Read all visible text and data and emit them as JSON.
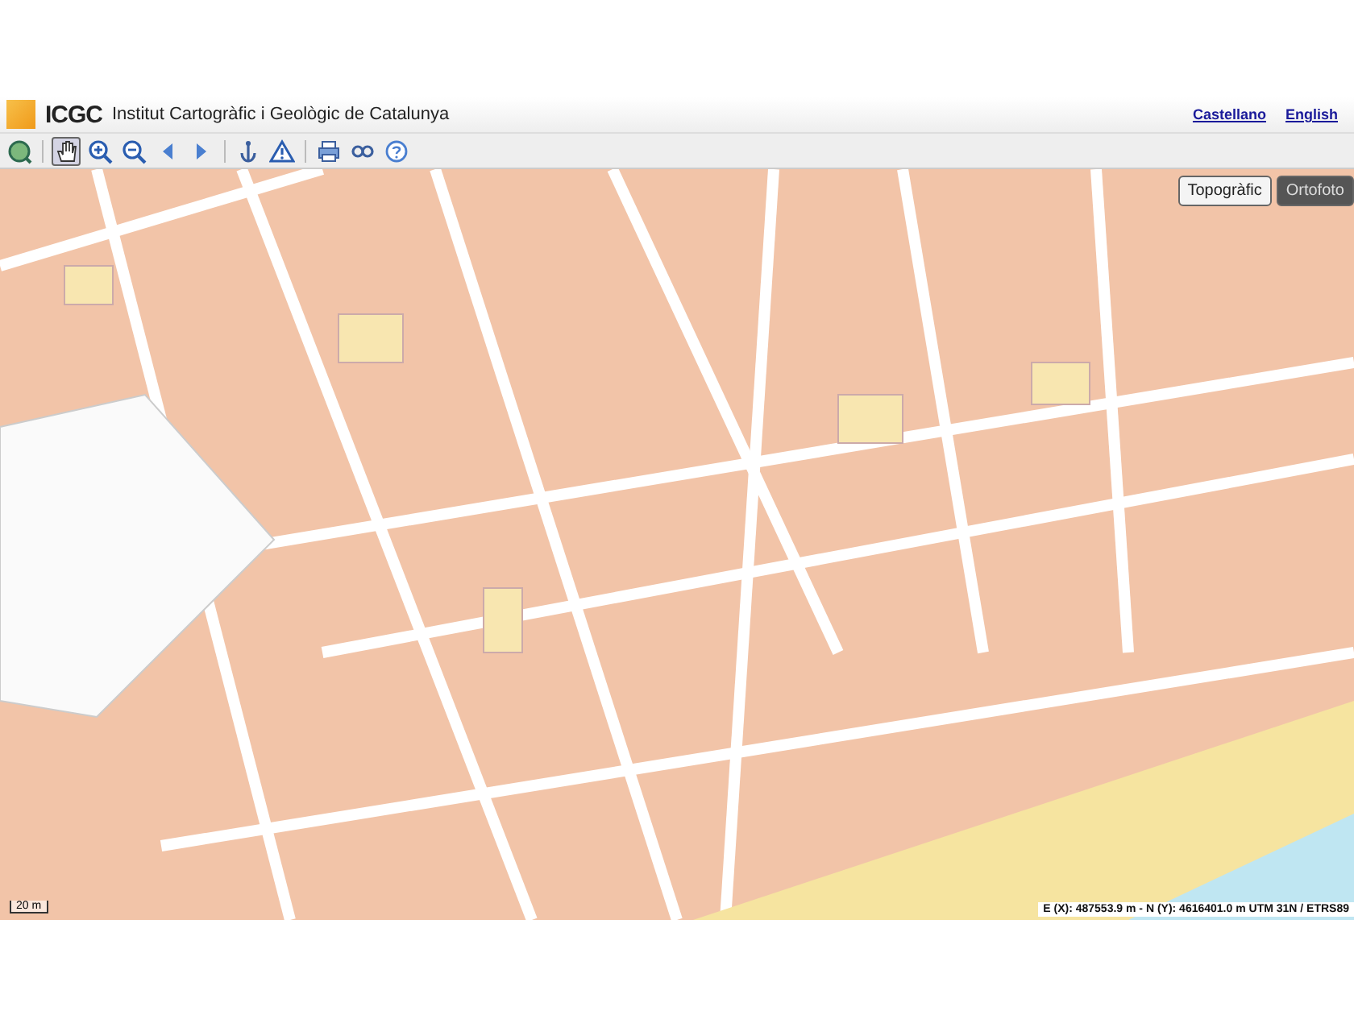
{
  "header": {
    "logo_text": "ICGC",
    "title": "Institut Cartogràfic i Geològic de Catalunya",
    "languages": [
      {
        "label": "Castellano"
      },
      {
        "label": "English"
      }
    ]
  },
  "toolbar": {
    "groups": [
      {
        "tools": [
          {
            "kind": "extent",
            "selected": false
          }
        ]
      },
      {
        "tools": [
          {
            "kind": "pan",
            "selected": true
          },
          {
            "kind": "zoomin",
            "selected": false
          },
          {
            "kind": "zoomout",
            "selected": false
          },
          {
            "kind": "back",
            "selected": false
          },
          {
            "kind": "forward",
            "selected": false
          }
        ]
      },
      {
        "tools": [
          {
            "kind": "anchor",
            "selected": false
          },
          {
            "kind": "warning",
            "selected": false
          }
        ]
      },
      {
        "tools": [
          {
            "kind": "print",
            "selected": false
          },
          {
            "kind": "link",
            "selected": false
          },
          {
            "kind": "help",
            "selected": false
          }
        ]
      }
    ]
  },
  "map": {
    "base_layers": [
      {
        "label": "Topogràfic",
        "selected": true
      },
      {
        "label": "Ortofoto",
        "selected": false
      }
    ],
    "scale": "20 m",
    "coordinates": "E (X): 487553.9 m - N (Y): 4616401.0 m UTM 31N / ETRS89"
  }
}
